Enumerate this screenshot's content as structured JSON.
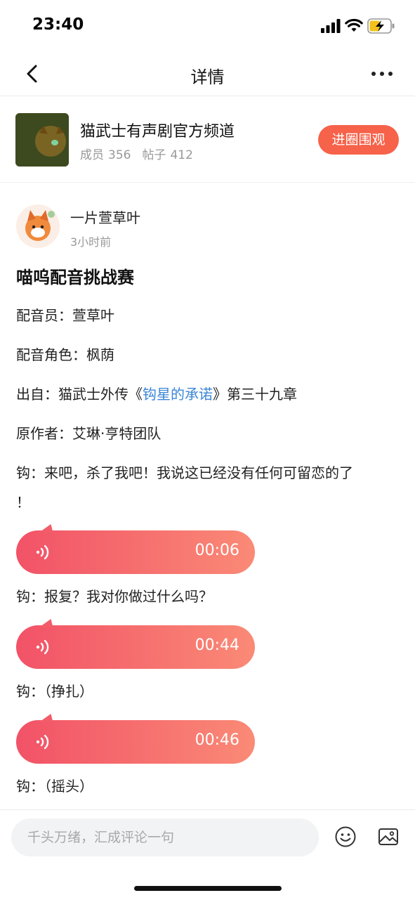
{
  "status_bar": {
    "time": "23:40"
  },
  "nav": {
    "title": "详情"
  },
  "channel": {
    "name": "猫武士有声剧官方频道",
    "members_label": "成员",
    "members": "356",
    "posts_label": "帖子",
    "posts": "412",
    "join_label": "进圈围观",
    "cover_text": "猫武士"
  },
  "post": {
    "author": "一片萱草叶",
    "time": "3小时前",
    "title": "喵呜配音挑战赛",
    "voice_actor": "配音员：萱草叶",
    "role": "配音角色：枫荫",
    "source_prefix": "出自：猫武士外传《",
    "source_book": "钩星的承诺",
    "source_suffix": "》第三十九章",
    "original_author": "原作者：艾琳·亨特团队",
    "line1a": "钩：来吧，杀了我吧！我说这已经没有任何可留恋的了",
    "line1b": "！",
    "line2": "钩：报复？我对你做过什么吗？",
    "line3": "钩：（挣扎）",
    "line4": "钩：（摇头）"
  },
  "voices": [
    {
      "duration": "00:06"
    },
    {
      "duration": "00:44"
    },
    {
      "duration": "00:46"
    }
  ],
  "comment": {
    "placeholder": "千头万绪，汇成评论一句"
  },
  "colors": {
    "accent": "#f7624a",
    "link": "#3b86d6",
    "voice_start": "#f25267",
    "voice_end": "#fa8a76"
  }
}
